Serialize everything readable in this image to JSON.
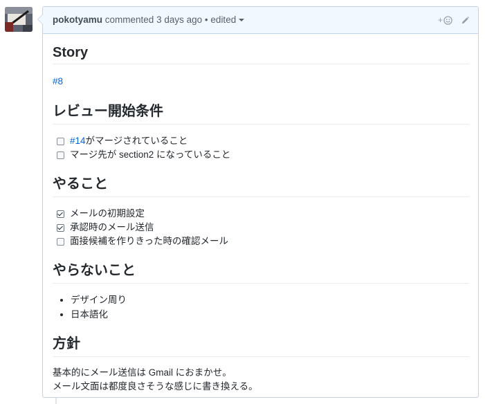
{
  "comment": {
    "author": "pokotyamu",
    "action": "commented",
    "time": "3 days ago",
    "separator": "•",
    "edited_label": "edited",
    "reaction_plus": "+",
    "icons": {
      "avatar": "avatar-icon",
      "reaction": "smiley-icon",
      "edit": "pencil-icon",
      "edited": "chevron-down-icon"
    },
    "colors": {
      "link": "#0366d6",
      "header_bg": "#f1f8ff",
      "border": "#c0d3eb"
    }
  },
  "story": {
    "heading": "Story",
    "link": "#8"
  },
  "review_conditions": {
    "heading": "レビュー開始条件",
    "items": [
      {
        "checked": false,
        "link": "#14",
        "text": " がマージされていること"
      },
      {
        "checked": false,
        "text": "マージ先が section2 になっていること"
      }
    ]
  },
  "todo": {
    "heading": "やること",
    "items": [
      {
        "checked": true,
        "text": "メールの初期設定"
      },
      {
        "checked": true,
        "text": "承認時のメール送信"
      },
      {
        "checked": false,
        "text": "面接候補を作りきった時の確認メール"
      }
    ]
  },
  "not_todo": {
    "heading": "やらないこと",
    "items": [
      "デザイン周り",
      "日本語化"
    ]
  },
  "policy": {
    "heading": "方針",
    "lines": [
      "基本的にメール送信は Gmail におまかせ。",
      "メール文面は都度良さそうな感じに書き換える。"
    ]
  }
}
